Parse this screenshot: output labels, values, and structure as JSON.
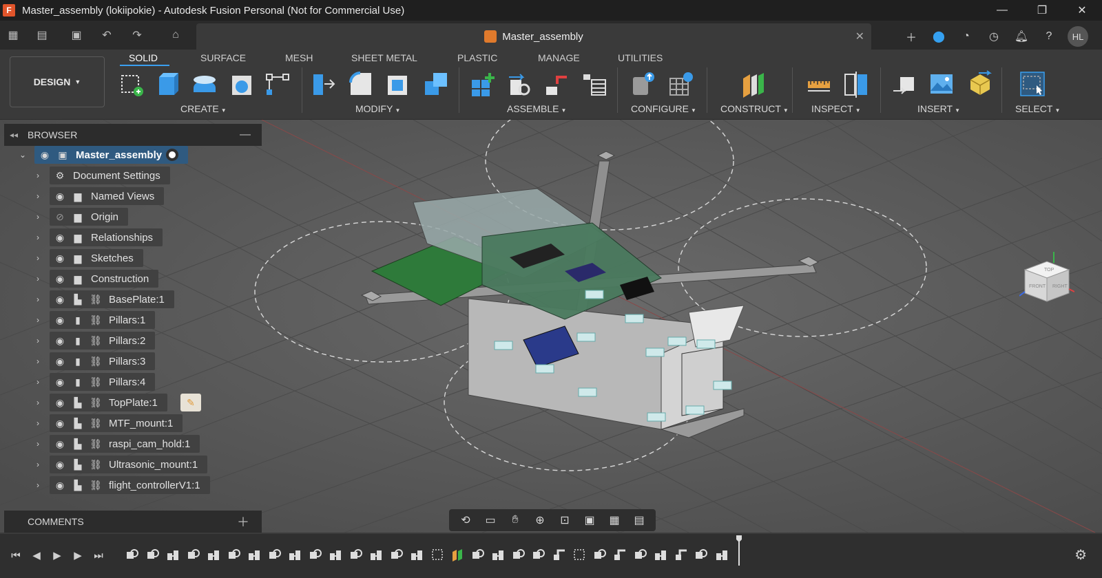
{
  "window": {
    "title": "Master_assembly (lokiipokie) - Autodesk Fusion Personal (Not for Commercial Use)",
    "app_icon": "F",
    "controls": [
      "minimize-icon",
      "restore-icon",
      "close-icon"
    ]
  },
  "tabbar": {
    "document_tab": "Master_assembly",
    "user_initials": "HL"
  },
  "ribbon": {
    "workspace": "DESIGN",
    "workspace_tabs": [
      "SOLID",
      "SURFACE",
      "MESH",
      "SHEET METAL",
      "PLASTIC",
      "MANAGE",
      "UTILITIES"
    ],
    "active_tab": "SOLID",
    "groups": [
      "CREATE",
      "MODIFY",
      "ASSEMBLE",
      "CONFIGURE",
      "CONSTRUCT",
      "INSPECT",
      "INSERT",
      "SELECT"
    ]
  },
  "browser": {
    "title": "BROWSER",
    "root": "Master_assembly",
    "items": [
      {
        "label": "Document Settings",
        "icon": "gear-icon"
      },
      {
        "label": "Named Views",
        "icon": "folder-icon"
      },
      {
        "label": "Origin",
        "icon": "folder-icon",
        "hidden": true
      },
      {
        "label": "Relationships",
        "icon": "folder-icon"
      },
      {
        "label": "Sketches",
        "icon": "folder-icon"
      },
      {
        "label": "Construction",
        "icon": "folder-icon"
      },
      {
        "label": "BasePlate:1",
        "icon": "component-icon"
      },
      {
        "label": "Pillars:1",
        "icon": "body-icon"
      },
      {
        "label": "Pillars:2",
        "icon": "body-icon"
      },
      {
        "label": "Pillars:3",
        "icon": "body-icon"
      },
      {
        "label": "Pillars:4",
        "icon": "body-icon"
      },
      {
        "label": "TopPlate:1",
        "icon": "component-icon"
      },
      {
        "label": "MTF_mount:1",
        "icon": "component-icon"
      },
      {
        "label": "raspi_cam_hold:1",
        "icon": "component-icon"
      },
      {
        "label": "Ultrasonic_mount:1",
        "icon": "component-icon"
      },
      {
        "label": "flight_controllerV1:1",
        "icon": "component-icon"
      }
    ]
  },
  "comments": {
    "title": "COMMENTS"
  },
  "viewcube": {
    "top": "TOP",
    "front": "FRONT",
    "right": "RIGHT"
  },
  "colors": {
    "accent": "#3aa0f0",
    "viewport": "#585858",
    "root_highlight": "#2f5a80"
  }
}
